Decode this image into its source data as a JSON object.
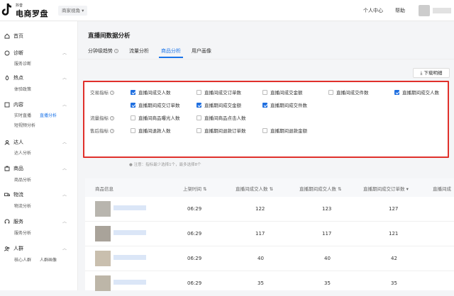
{
  "topbar": {
    "logo_small": "抖音",
    "logo_main": "电商罗盘",
    "merchant_view": "商家视角",
    "personal_center": "个人中心",
    "help": "帮助"
  },
  "sidebar": {
    "home": "首页",
    "sections": [
      {
        "label": "诊断",
        "subs": [
          "服务诊断"
        ]
      },
      {
        "label": "热点",
        "subs": [
          "体验政策"
        ]
      },
      {
        "label": "内容",
        "subs": [
          "实时直播",
          "直播分析",
          "短视频分析"
        ]
      },
      {
        "label": "达人",
        "subs": [
          "达人分析"
        ]
      },
      {
        "label": "商品",
        "subs": [
          "商品分析"
        ]
      },
      {
        "label": "物流",
        "subs": [
          "物流分析"
        ]
      },
      {
        "label": "服务",
        "subs": [
          "服务分析"
        ]
      },
      {
        "label": "人群",
        "subs": [
          "核心人群",
          "人群画像"
        ]
      }
    ]
  },
  "main": {
    "title": "直播间数据分析",
    "tabs": [
      "分钟级趋势",
      "流量分析",
      "商品分析",
      "用户画像"
    ],
    "download": "下载明细",
    "metric_groups": [
      {
        "label": "交易指标",
        "items": [
          {
            "label": "直播间成交人数",
            "checked": true
          },
          {
            "label": "直播间成交订单数",
            "checked": false
          },
          {
            "label": "直播间成交金额",
            "checked": false
          },
          {
            "label": "直播间成交件数",
            "checked": false
          },
          {
            "label": "直播期间成交人数",
            "checked": true
          },
          {
            "label": "直播期间成交订单数",
            "checked": true
          },
          {
            "label": "直播期间成交金额",
            "checked": true
          },
          {
            "label": "直播期间成交件数",
            "checked": true
          }
        ]
      },
      {
        "label": "流量指标",
        "items": [
          {
            "label": "直播间商品曝光人数",
            "checked": false
          },
          {
            "label": "直播间商品点击人数",
            "checked": false
          }
        ]
      },
      {
        "label": "售后指标",
        "items": [
          {
            "label": "直播间退款人数",
            "checked": false
          },
          {
            "label": "直播期间退款订单数",
            "checked": false
          },
          {
            "label": "直播期间退款金额",
            "checked": false
          }
        ]
      }
    ],
    "note": "注意：指标最少选择1个，最多选择8个",
    "table": {
      "headers": [
        "商品信息",
        "上架时间",
        "直播间成交人数",
        "直播期间成交人数",
        "直播期间成交订单数",
        "直播间成"
      ],
      "rows": [
        {
          "time": "06:29",
          "c1": "122",
          "c2": "123",
          "c3": "127"
        },
        {
          "time": "06:29",
          "c1": "117",
          "c2": "117",
          "c3": "121"
        },
        {
          "time": "06:29",
          "c1": "40",
          "c2": "40",
          "c3": "42"
        },
        {
          "time": "06:29",
          "c1": "35",
          "c2": "35",
          "c3": "35"
        }
      ]
    }
  }
}
